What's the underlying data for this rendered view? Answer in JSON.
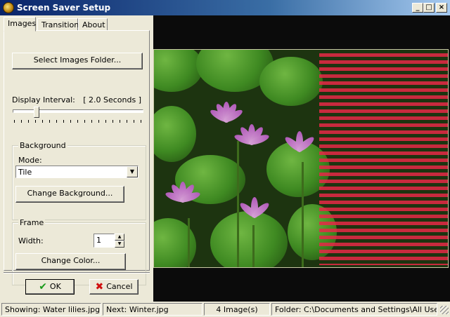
{
  "window": {
    "title": "Screen Saver Setup",
    "min_glyph": "_",
    "max_glyph": "□",
    "close_glyph": "×"
  },
  "tabs": [
    {
      "label": "Images",
      "active": true
    },
    {
      "label": "Transition",
      "active": false
    },
    {
      "label": "About",
      "active": false
    }
  ],
  "images_tab": {
    "select_folder_label": "Select Images Folder...",
    "display_interval_label": "Display Interval:",
    "display_interval_value": "[ 2.0 Seconds ]",
    "slider_value_fraction": 0.17
  },
  "background": {
    "group_label": "Background",
    "mode_label": "Mode:",
    "mode_value": "Tile",
    "change_background_label": "Change Background..."
  },
  "frame": {
    "group_label": "Frame",
    "width_label": "Width:",
    "width_value": "1",
    "change_color_label": "Change Color..."
  },
  "footer": {
    "ok_label": "OK",
    "cancel_label": "Cancel"
  },
  "status": {
    "showing": "Showing: Water lilies.jpg",
    "next": "Next: Winter.jpg",
    "count": "4 Image(s)",
    "folder": "Folder: C:\\Documents and Settings\\All Users\\Docum"
  },
  "colors": {
    "titlebar_start": "#0a246a",
    "titlebar_end": "#a6caf0",
    "ok_icon": "#1a9a1a",
    "cancel_icon": "#d01010",
    "transition_stripes": "#e62846"
  },
  "icons": {
    "app": "app-globe-icon",
    "ok": "checkmark-icon",
    "cancel": "cross-icon",
    "dropdown": "chevron-down-icon"
  }
}
